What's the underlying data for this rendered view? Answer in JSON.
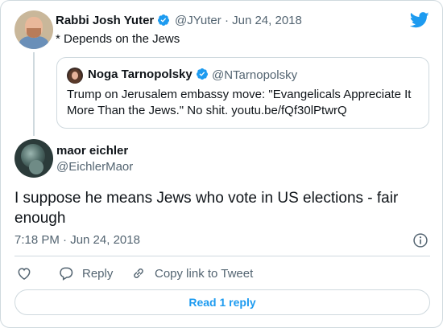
{
  "parent_tweet": {
    "author_name": "Rabbi Josh Yuter",
    "handle": "@JYuter",
    "separator": "·",
    "date": "Jun 24, 2018",
    "text": "* Depends on the Jews"
  },
  "quoted_tweet": {
    "author_name": "Noga Tarnopolsky",
    "handle": "@NTarnopolsky",
    "text": "Trump on Jerusalem embassy move: \"Evangelicals Appreciate It More Than the Jews.\" No shit. youtu.be/fQf30lPtwrQ"
  },
  "main_tweet": {
    "author_name": "maor eichler",
    "handle": "@EichlerMaor",
    "text": "I suppose he means Jews who vote in US elections - fair enough",
    "timestamp": "7:18 PM · Jun 24, 2018"
  },
  "actions": {
    "reply_label": "Reply",
    "copy_label": "Copy link to Tweet"
  },
  "read_replies_label": "Read 1 reply",
  "colors": {
    "brand_blue": "#1d9bf0",
    "text_primary": "#0f1419",
    "text_secondary": "#536471",
    "border": "#cfd9de"
  },
  "icons": [
    "twitter-logo-icon",
    "verified-badge-icon",
    "info-icon",
    "heart-icon",
    "reply-bubble-icon",
    "link-icon"
  ]
}
